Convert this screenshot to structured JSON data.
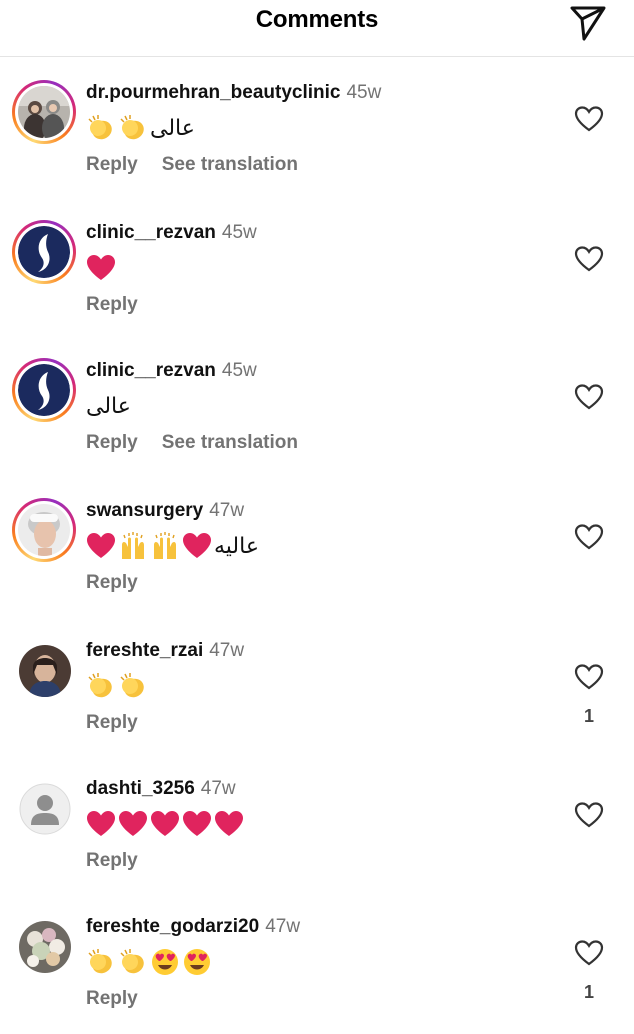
{
  "header": {
    "title": "Comments",
    "send_icon": "paper-plane-icon"
  },
  "colors": {
    "story_ring": [
      "#feda75",
      "#fa7e1e",
      "#d62976",
      "#962fbf"
    ],
    "meta_gray": "#737373",
    "heart_red": "#e0245e"
  },
  "comments": [
    {
      "username": "dr.pourmehran_beautyclinic",
      "time": "45w",
      "text": "عالی",
      "emojis_after_text": [
        "clapping-hands",
        "clapping-hands"
      ],
      "reply": "Reply",
      "translation": "See translation",
      "likes": ""
    },
    {
      "username": "clinic__rezvan",
      "time": "45w",
      "text": "",
      "emojis_after_text": [
        "red-heart"
      ],
      "reply": "Reply",
      "translation": "",
      "likes": ""
    },
    {
      "username": "clinic__rezvan",
      "time": "45w",
      "text": "عالی",
      "emojis_after_text": [],
      "reply": "Reply",
      "translation": "See translation",
      "likes": ""
    },
    {
      "username": "swansurgery",
      "time": "47w",
      "text": "عالیه",
      "emojis_after_text": [
        "red-heart",
        "raising-hands",
        "raising-hands",
        "red-heart"
      ],
      "reply": "Reply",
      "translation": "",
      "likes": ""
    },
    {
      "username": "fereshte_rzai",
      "time": "47w",
      "text": "",
      "emojis_after_text": [
        "clapping-hands",
        "clapping-hands"
      ],
      "reply": "Reply",
      "translation": "",
      "likes": "1"
    },
    {
      "username": "dashti_3256",
      "time": "47w",
      "text": "",
      "emojis_after_text": [
        "red-heart",
        "red-heart",
        "red-heart",
        "red-heart",
        "red-heart"
      ],
      "reply": "Reply",
      "translation": "",
      "likes": ""
    },
    {
      "username": "fereshte_godarzi20",
      "time": "47w",
      "text": "",
      "emojis_after_text": [
        "clapping-hands",
        "clapping-hands",
        "heart-eyes-face",
        "heart-eyes-face"
      ],
      "reply": "Reply",
      "translation": "",
      "likes": "1"
    }
  ]
}
